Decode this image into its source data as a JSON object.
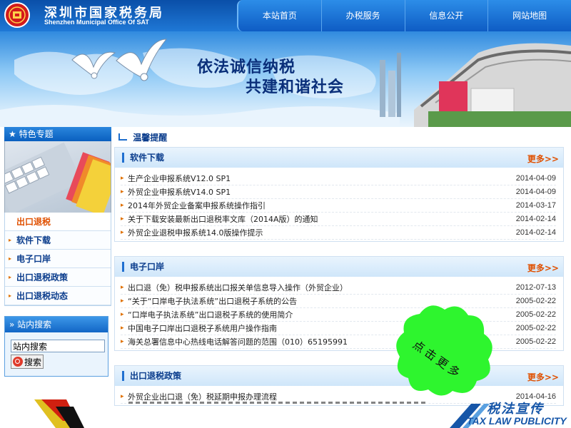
{
  "header": {
    "title": "深圳市国家税务局",
    "subtitle": "Shenzhen Municipal Office Of SAT",
    "nav": [
      "本站首页",
      "办税服务",
      "信息公开",
      "网站地图"
    ],
    "slogan_line1": "依法诚信纳税",
    "slogan_line2": "共建和谐社会"
  },
  "sidebar": {
    "heading": "特色专题",
    "menu": [
      {
        "label": "出口退税",
        "active": true
      },
      {
        "label": "软件下载",
        "active": false
      },
      {
        "label": "电子口岸",
        "active": false
      },
      {
        "label": "出口退税政策",
        "active": false
      },
      {
        "label": "出口退税动态",
        "active": false
      }
    ],
    "search": {
      "heading": "站内搜索",
      "input_value": "站内搜索",
      "button_label": "搜索"
    }
  },
  "main": {
    "notice": "温馨提醒",
    "sections": [
      {
        "title": "软件下载",
        "more": "更多>>",
        "items": [
          {
            "title": "生产企业申报系统V12.0 SP1",
            "date": "2014-04-09"
          },
          {
            "title": "外贸企业申报系统V14.0 SP1",
            "date": "2014-04-09"
          },
          {
            "title": "2014年外贸企业备案申报系统操作指引",
            "date": "2014-03-17"
          },
          {
            "title": "关于下载安装最新出口退税率文库（2014A版）的通知",
            "date": "2014-02-14"
          },
          {
            "title": "外贸企业退税申报系统14.0版操作提示",
            "date": "2014-02-14"
          }
        ]
      },
      {
        "title": "电子口岸",
        "more": "更多>>",
        "items": [
          {
            "title": "出口退（免）税申报系统出口报关单信息导入操作（外贸企业）",
            "date": "2012-07-13"
          },
          {
            "title": "“关于“口岸电子执法系统”出口退税子系统的公告",
            "date": "2005-02-22"
          },
          {
            "title": "“口岸电子执法系统”出口退税子系统的使用简介",
            "date": "2005-02-22"
          },
          {
            "title": "中国电子口岸出口退税子系统用户操作指南",
            "date": "2005-02-22"
          },
          {
            "title": "海关总署信息中心热线电话解答问题的范围（010）65195991",
            "date": "2005-02-22"
          }
        ]
      },
      {
        "title": "出口退税政策",
        "more": "更多>>",
        "items": [
          {
            "title": "外贸企业出口退（免）税延期申报办理流程",
            "date": "2014-04-16"
          }
        ]
      }
    ]
  },
  "overlay": {
    "callout": "点击更多",
    "taxlaw_cn": "税法宣传",
    "taxlaw_en": "TAX LAW PUBLICITY"
  },
  "colors": {
    "primary_blue": "#0a5fbf",
    "link_blue": "#0a3c8c",
    "accent_orange": "#e05000",
    "callout_green": "#2ef52e"
  }
}
